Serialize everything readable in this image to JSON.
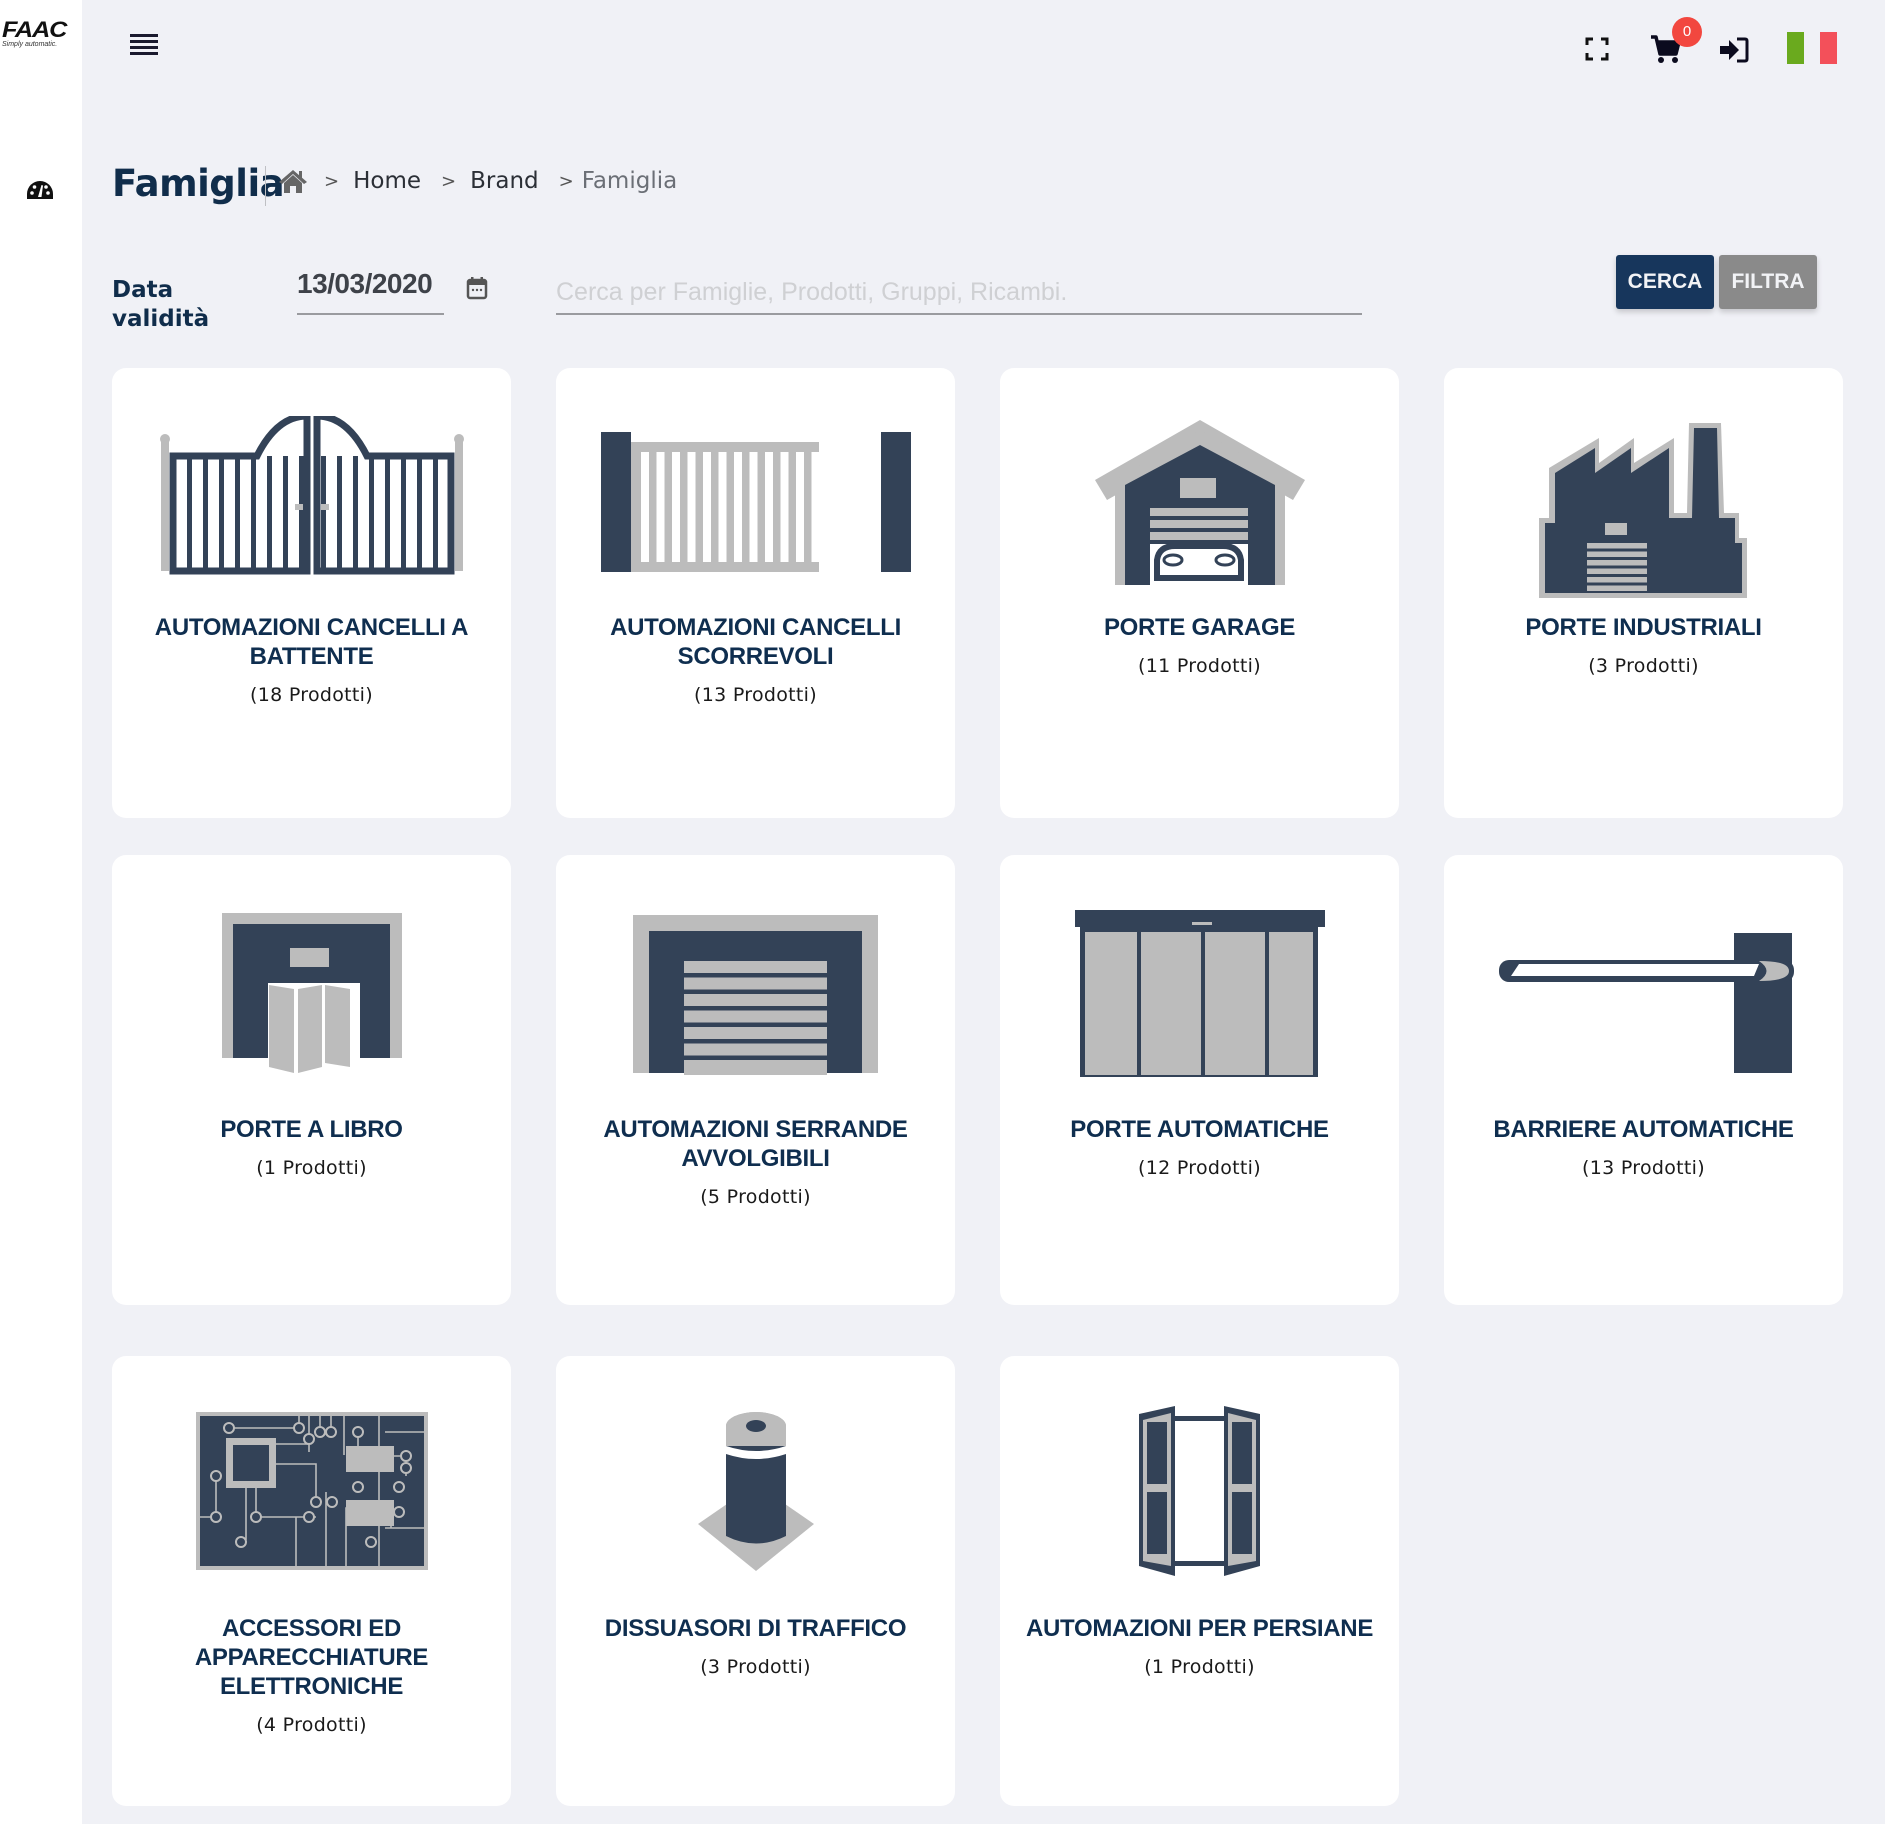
{
  "brand": {
    "name": "FAAC",
    "tagline": "Simply automatic."
  },
  "header": {
    "icons": [
      "menu-icon",
      "fullscreen-icon",
      "cart-icon",
      "login-icon",
      "italian-flag"
    ],
    "cart_count": "0",
    "flag_colors": [
      "#6aaa1e",
      "#f0f1f6",
      "#f3505a"
    ]
  },
  "sidebar": {
    "items": [
      {
        "icon": "dashboard-icon"
      }
    ]
  },
  "page": {
    "title": "Famiglia",
    "breadcrumb": [
      {
        "label": "Home"
      },
      {
        "label": "Brand"
      },
      {
        "label": "Famiglia"
      }
    ]
  },
  "filters": {
    "date_label_line1": "Data",
    "date_label_line2": "validità",
    "date_value": "13/03/2020",
    "search_placeholder": "Cerca per Famiglie, Prodotti, Gruppi, Ricambi.",
    "search_value": "",
    "cerca_label": "CERCA",
    "filtra_label": "FILTRA"
  },
  "colors": {
    "primary": "#17365c",
    "title": "#0f2e4f",
    "icon_dark": "#334257",
    "icon_light": "#bcbcbc",
    "secondary_button": "#8a8a8a",
    "badge": "#f2473f"
  },
  "families": [
    {
      "title": "AUTOMAZIONI CANCELLI A BATTENTE",
      "count": "(18 Prodotti)",
      "icon": "swing-gate-icon"
    },
    {
      "title": "AUTOMAZIONI CANCELLI SCORREVOLI",
      "count": "(13 Prodotti)",
      "icon": "sliding-gate-icon"
    },
    {
      "title": "PORTE GARAGE",
      "count": "(11 Prodotti)",
      "icon": "garage-icon"
    },
    {
      "title": "PORTE INDUSTRIALI",
      "count": "(3 Prodotti)",
      "icon": "factory-icon"
    },
    {
      "title": "PORTE A LIBRO",
      "count": "(1 Prodotti)",
      "icon": "folding-door-icon"
    },
    {
      "title": "AUTOMAZIONI SERRANDE AVVOLGIBILI",
      "count": "(5 Prodotti)",
      "icon": "rolling-shutter-icon"
    },
    {
      "title": "PORTE AUTOMATICHE",
      "count": "(12 Prodotti)",
      "icon": "automatic-door-icon"
    },
    {
      "title": "BARRIERE AUTOMATICHE",
      "count": "(13 Prodotti)",
      "icon": "barrier-icon"
    },
    {
      "title": "ACCESSORI ED APPARECCHIATURE ELETTRONICHE",
      "count": "(4 Prodotti)",
      "icon": "circuit-board-icon"
    },
    {
      "title": "DISSUASORI DI TRAFFICO",
      "count": "(3 Prodotti)",
      "icon": "bollard-icon"
    },
    {
      "title": "AUTOMAZIONI PER PERSIANE",
      "count": "(1 Prodotti)",
      "icon": "shutters-icon"
    }
  ]
}
